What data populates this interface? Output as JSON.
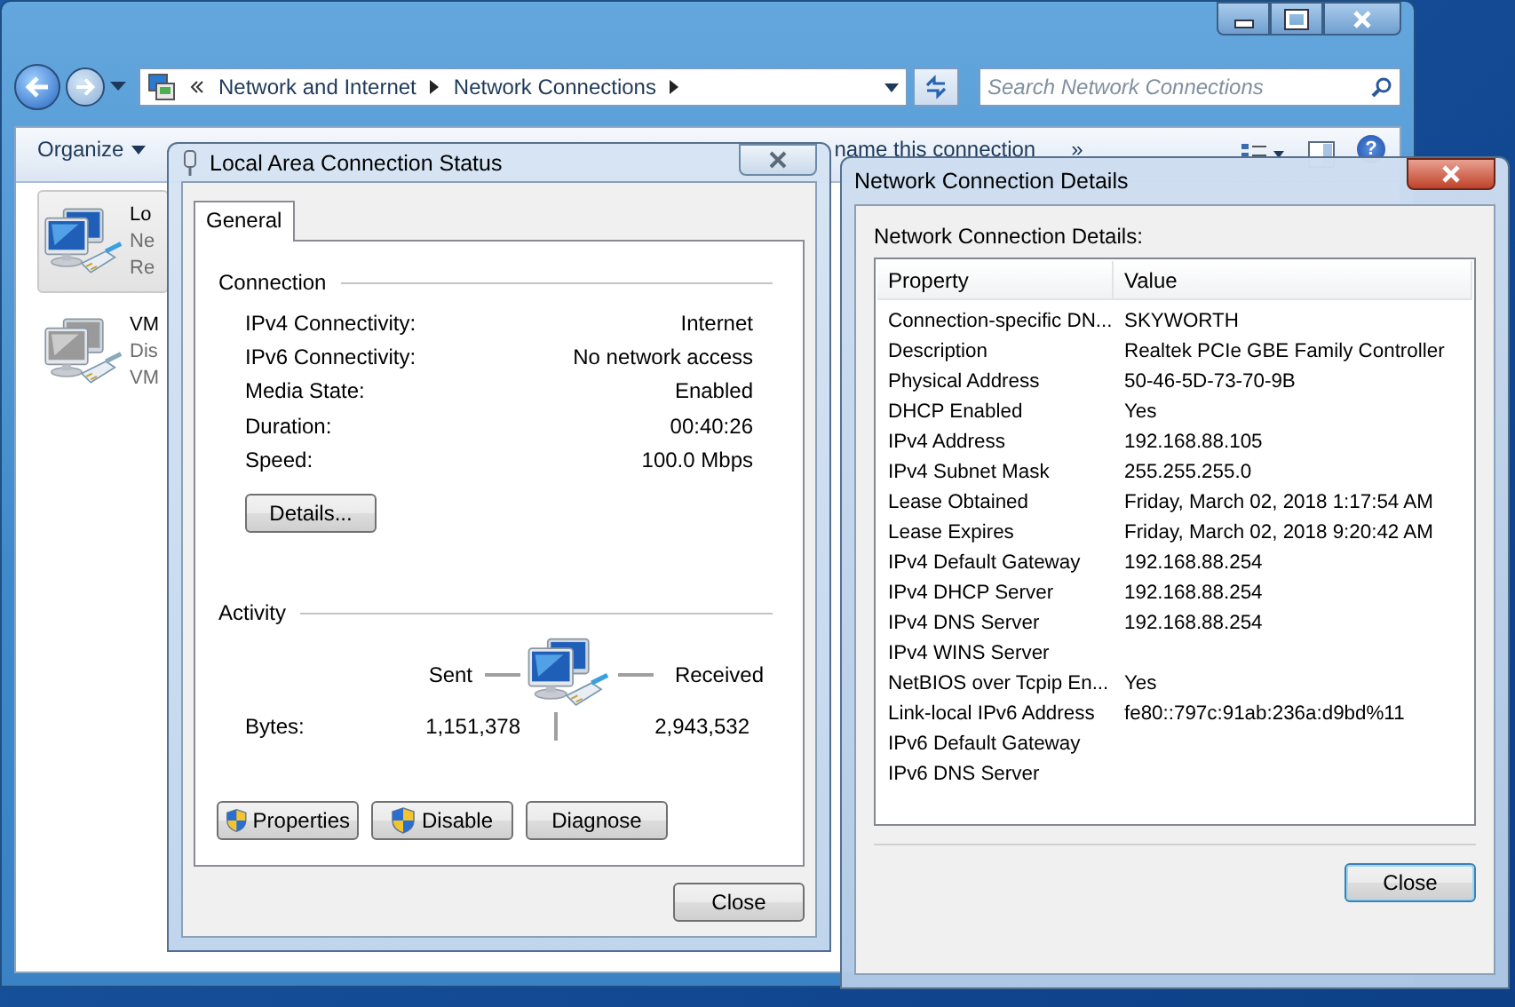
{
  "explorer": {
    "breadcrumb": [
      "Network and Internet",
      "Network Connections"
    ],
    "search": {
      "placeholder": "Search Network Connections"
    },
    "toolbar": [
      {
        "label": "Organize",
        "kind": "menu"
      },
      {
        "label": "name this connection",
        "kind": "plain"
      },
      {
        "label": "»",
        "kind": "plain"
      }
    ],
    "help": "?",
    "connections": [
      {
        "name": "Lo",
        "status": "Ne",
        "device": "Re",
        "selected": true,
        "enabled": true
      },
      {
        "name": "VM",
        "status": "Dis",
        "device": "VM",
        "selected": false,
        "enabled": false
      }
    ]
  },
  "status_dialog": {
    "title": "Local Area Connection Status",
    "tabs": [
      {
        "label": "General",
        "selected": true
      }
    ],
    "connection": {
      "heading": "Connection",
      "rows": [
        {
          "label": "IPv4 Connectivity:",
          "value": "Internet"
        },
        {
          "label": "IPv6 Connectivity:",
          "value": "No network access"
        },
        {
          "label": "Media State:",
          "value": "Enabled"
        },
        {
          "label": "Duration:",
          "value": "00:40:26"
        },
        {
          "label": "Speed:",
          "value": "100.0 Mbps"
        }
      ],
      "details_button": "Details..."
    },
    "activity": {
      "heading": "Activity",
      "sent_label": "Sent",
      "received_label": "Received",
      "bytes_label": "Bytes:",
      "bytes_sent": "1,151,378",
      "bytes_received": "2,943,532"
    },
    "buttons": [
      {
        "label": "Properties",
        "shield": true
      },
      {
        "label": "Disable",
        "shield": true
      },
      {
        "label": "Diagnose",
        "shield": false
      }
    ],
    "close": "Close"
  },
  "details_dialog": {
    "title": "Network Connection Details",
    "caption": "Network Connection Details:",
    "columns": [
      "Property",
      "Value"
    ],
    "rows": [
      {
        "property": "Connection-specific DN...",
        "value": "SKYWORTH"
      },
      {
        "property": "Description",
        "value": "Realtek PCIe GBE Family Controller"
      },
      {
        "property": "Physical Address",
        "value": "50-46-5D-73-70-9B"
      },
      {
        "property": "DHCP Enabled",
        "value": "Yes"
      },
      {
        "property": "IPv4 Address",
        "value": "192.168.88.105"
      },
      {
        "property": "IPv4 Subnet Mask",
        "value": "255.255.255.0"
      },
      {
        "property": "Lease Obtained",
        "value": "Friday, March 02, 2018 1:17:54 AM"
      },
      {
        "property": "Lease Expires",
        "value": "Friday, March 02, 2018 9:20:42 AM"
      },
      {
        "property": "IPv4 Default Gateway",
        "value": "192.168.88.254"
      },
      {
        "property": "IPv4 DHCP Server",
        "value": "192.168.88.254"
      },
      {
        "property": "IPv4 DNS Server",
        "value": "192.168.88.254"
      },
      {
        "property": "IPv4 WINS Server"
      },
      {
        "property": "NetBIOS over Tcpip En...",
        "value": "Yes"
      },
      {
        "property": "Link-local IPv6 Address",
        "value": "fe80::797c:91ab:236a:d9bd%11"
      },
      {
        "property": "IPv6 Default Gateway"
      },
      {
        "property": "IPv6 DNS Server"
      }
    ],
    "close": "Close"
  }
}
